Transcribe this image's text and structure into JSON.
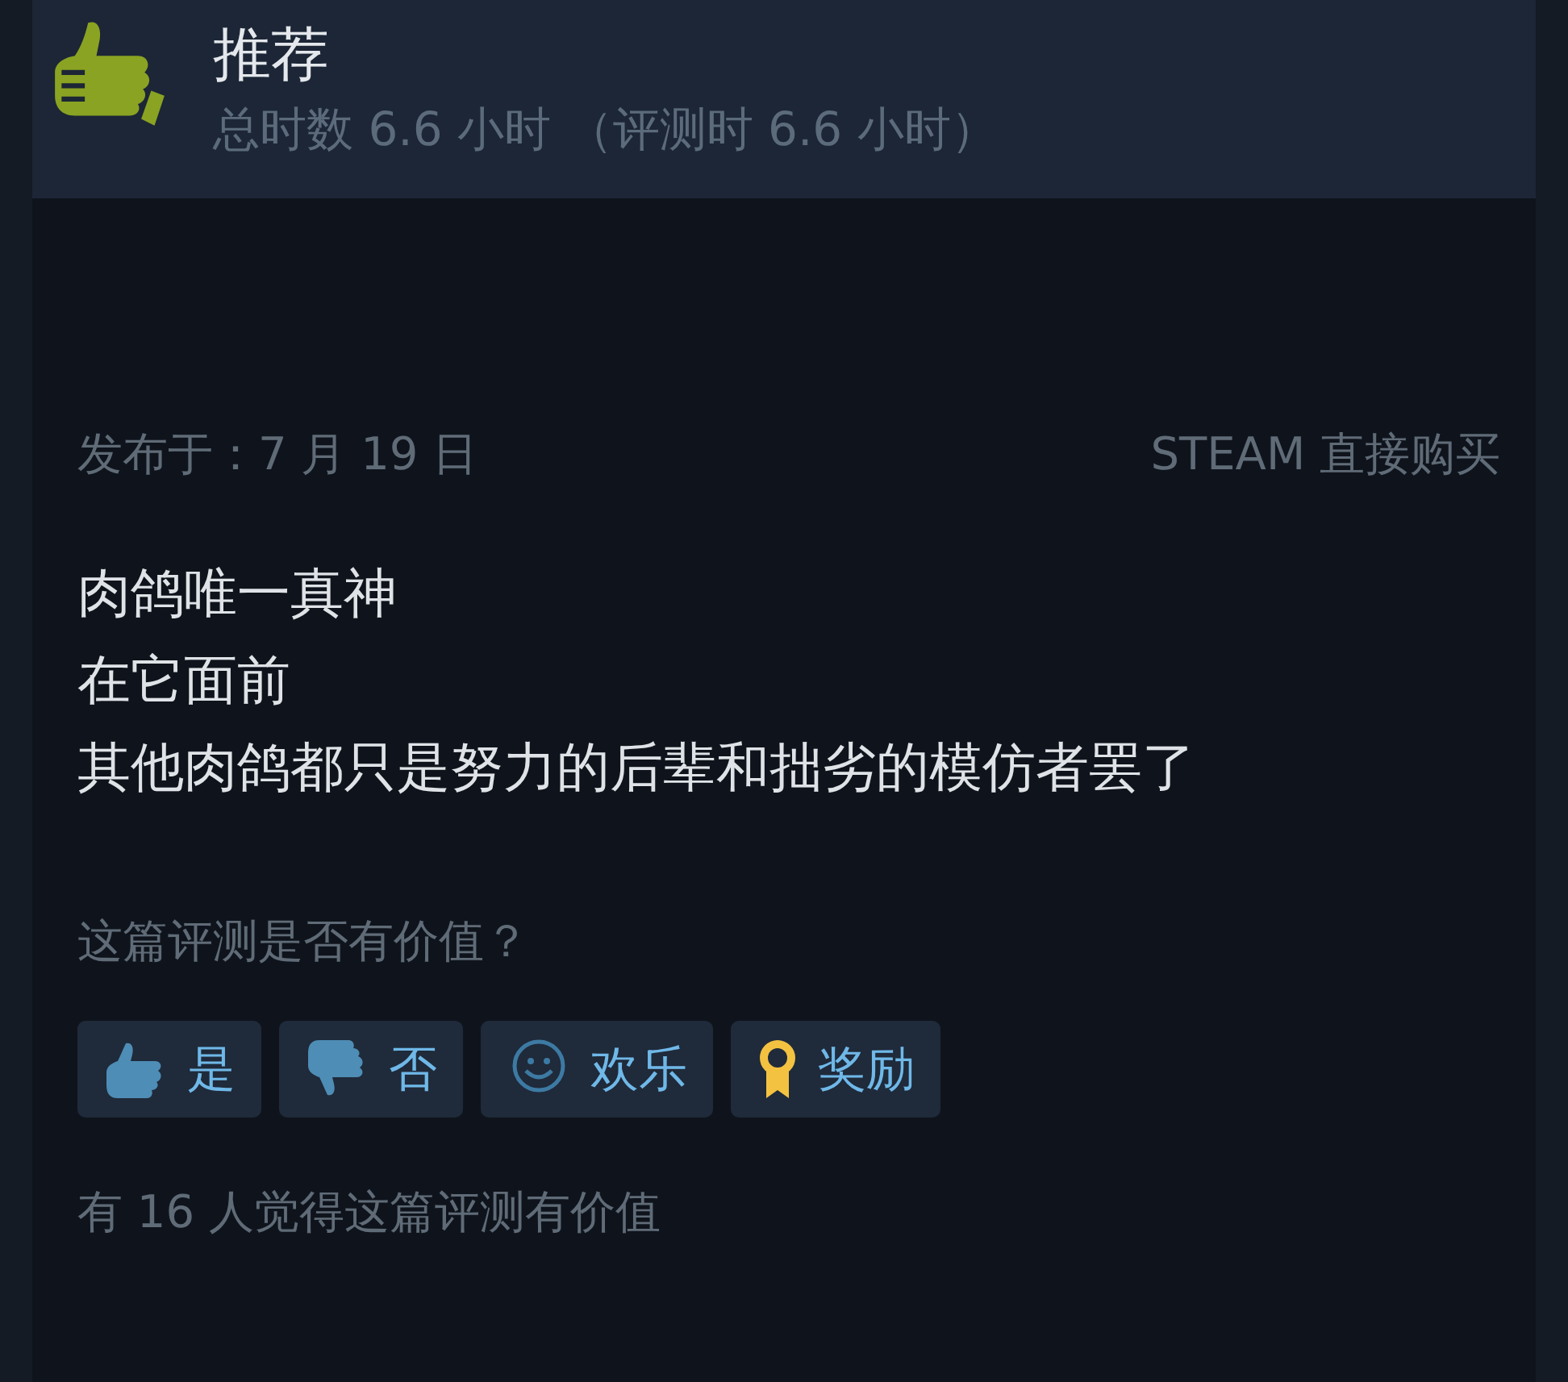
{
  "verdict": {
    "kind": "recommended",
    "title": "推荐",
    "hours": "总时数 6.6 小时 （评测时 6.6 小时）"
  },
  "meta": {
    "posted": "发布于：7 月 19 日",
    "source": "STEAM 直接购买"
  },
  "review_lines": [
    "肉鸽唯一真神",
    "在它面前",
    "其他肉鸽都只是努力的后辈和拙劣的模仿者罢了"
  ],
  "helpful_prompt": "这篇评测是否有价值？",
  "buttons": [
    {
      "kind": "thumbs_up",
      "label": "是"
    },
    {
      "kind": "thumbs_down",
      "label": "否"
    },
    {
      "kind": "smile",
      "label": "欢乐"
    },
    {
      "kind": "award",
      "label": "奖励"
    }
  ],
  "helpful_count": "有 16 人觉得这篇评测有价值"
}
